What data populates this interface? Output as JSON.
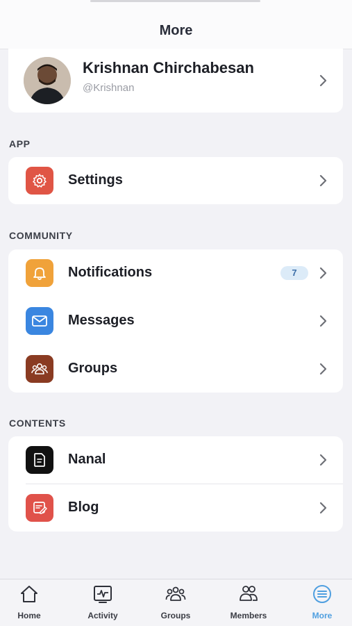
{
  "header": {
    "title": "More"
  },
  "profile": {
    "name": "Krishnan Chirchabesan",
    "handle": "@Krishnan"
  },
  "sections": {
    "app": {
      "label": "APP",
      "items": [
        {
          "label": "Settings",
          "icon": "gear-icon",
          "color": "#e05545"
        }
      ]
    },
    "community": {
      "label": "COMMUNITY",
      "items": [
        {
          "label": "Notifications",
          "icon": "bell-icon",
          "color": "#f0a23a",
          "badge": "7"
        },
        {
          "label": "Messages",
          "icon": "mail-icon",
          "color": "#3a86e0"
        },
        {
          "label": "Groups",
          "icon": "groups-icon",
          "color": "#8a3b22"
        }
      ]
    },
    "contents": {
      "label": "CONTENTS",
      "items": [
        {
          "label": "Nanal",
          "icon": "document-icon",
          "color": "#111111"
        },
        {
          "label": "Blog",
          "icon": "blog-icon",
          "color": "#e0524a"
        }
      ]
    }
  },
  "tabbar": {
    "tabs": [
      {
        "label": "Home",
        "icon": "home-icon"
      },
      {
        "label": "Activity",
        "icon": "activity-icon"
      },
      {
        "label": "Groups",
        "icon": "groups-icon"
      },
      {
        "label": "Members",
        "icon": "members-icon"
      },
      {
        "label": "More",
        "icon": "menu-icon",
        "active": true
      }
    ],
    "active_color": "#4f9fe0"
  }
}
